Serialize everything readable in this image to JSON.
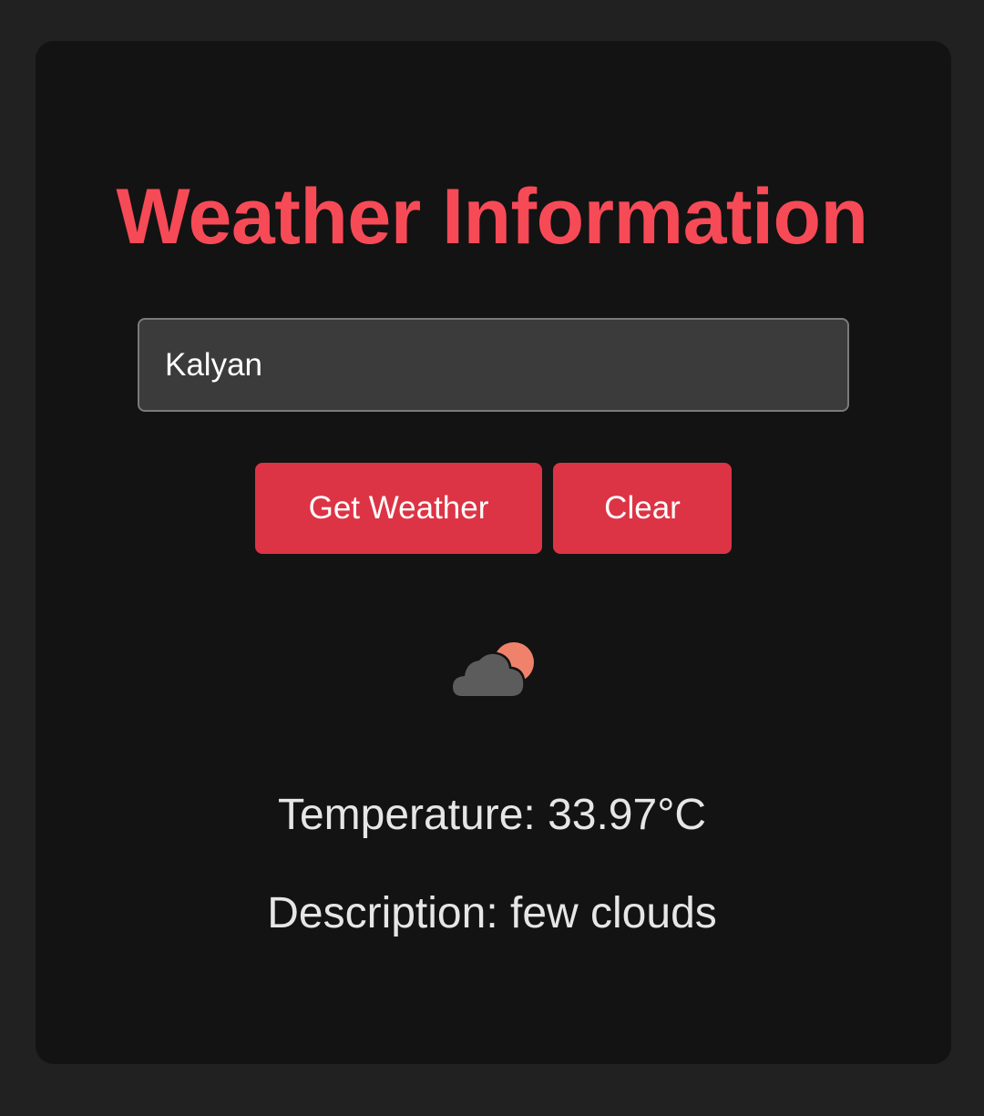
{
  "page": {
    "title": "Weather Information"
  },
  "search": {
    "value": "Kalyan"
  },
  "buttons": {
    "get_weather": "Get Weather",
    "clear": "Clear"
  },
  "weather": {
    "icon": "few-clouds-icon",
    "temperature": "Temperature: 33.97°C",
    "description": "Description: few clouds"
  },
  "colors": {
    "title": "#f74a57",
    "button": "#dc3445",
    "card": "#131313",
    "background": "#212121",
    "input": "#3b3b3b"
  }
}
